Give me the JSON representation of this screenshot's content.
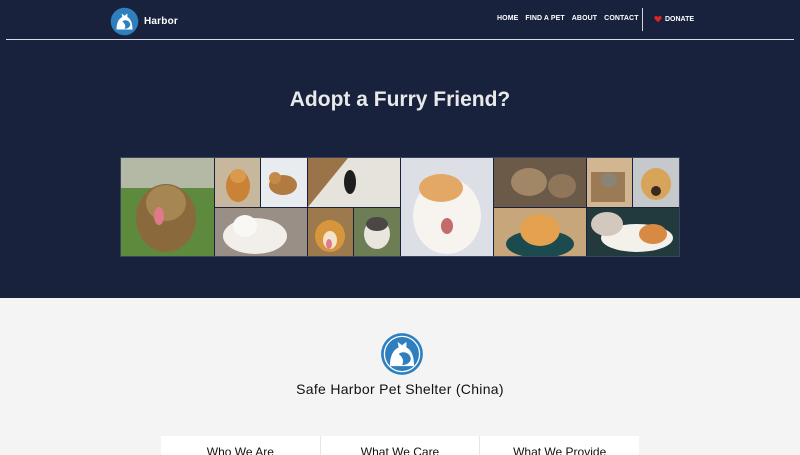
{
  "brand": {
    "name": "Harbor",
    "logo_icon": "dog-cat-circle-icon"
  },
  "nav": {
    "links": [
      "HOME",
      "FIND A PET",
      "ABOUT",
      "CONTACT"
    ],
    "donate_label": "DONATE",
    "donate_icon": "heart-icon"
  },
  "hero": {
    "title": "Adopt a Furry Friend?"
  },
  "gallery": {
    "photos": [
      "yorkie-dog-photo",
      "shiba-dog-photo",
      "shiba-snow-photo",
      "samoyed-dog-photo",
      "black-cat-photo",
      "corgi-dog-photo",
      "husky-dog-photo",
      "white-orange-cat-photo",
      "tabby-cats-photo",
      "cat-in-box-photo",
      "golden-retriever-photo",
      "orange-cat-basket-photo",
      "calico-cat-photo"
    ]
  },
  "content": {
    "org_name": "Safe Harbor Pet Shelter (China)",
    "cards": [
      "Who We Are",
      "What We Care",
      "What We Provide"
    ]
  },
  "colors": {
    "navy": "#18223d",
    "accent_blue": "#2d7fc0",
    "heart_red": "#e02424"
  }
}
